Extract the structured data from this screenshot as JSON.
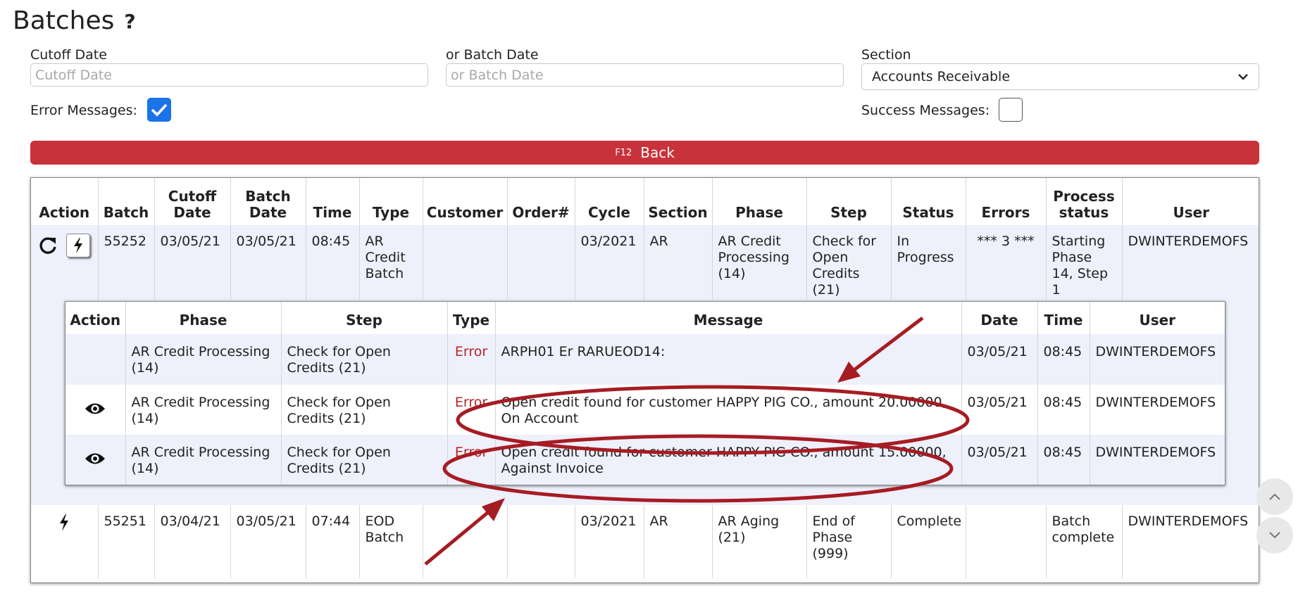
{
  "page": {
    "title": "Batches",
    "help_glyph": "?"
  },
  "filters": {
    "cutoff_label": "Cutoff Date",
    "cutoff_placeholder": "Cutoff Date",
    "batch_date_label": "or Batch Date",
    "batch_date_placeholder": "or Batch Date",
    "section_label": "Section",
    "section_value": "Accounts Receivable",
    "error_messages_label": "Error Messages:",
    "error_messages_checked": true,
    "success_messages_label": "Success Messages:",
    "success_messages_checked": false
  },
  "back_button": {
    "key": "F12",
    "label": "Back"
  },
  "batches": {
    "headers": {
      "action": "Action",
      "batch": "Batch",
      "cutoff_1": "Cutoff",
      "cutoff_2": "Date",
      "batch_date_1": "Batch",
      "batch_date_2": "Date",
      "time": "Time",
      "type": "Type",
      "customer": "Customer",
      "order": "Order#",
      "cycle": "Cycle",
      "section": "Section",
      "phase": "Phase",
      "step": "Step",
      "status": "Status",
      "errors": "Errors",
      "process_1": "Process",
      "process_2": "status",
      "user": "User"
    },
    "rows": [
      {
        "batch": "55252",
        "cutoff_date": "03/05/21",
        "batch_date": "03/05/21",
        "time": "08:45",
        "type": "AR Credit Batch",
        "customer": "",
        "order": "",
        "cycle": "03/2021",
        "section": "AR",
        "phase": "AR Credit Processing (14)",
        "step": "Check for Open Credits (21)",
        "status": "In Progress",
        "errors": "*** 3 ***",
        "process_status": "Starting Phase 14, Step 1",
        "user": "DWINTERDEMOFS"
      },
      {
        "batch": "55251",
        "cutoff_date": "03/04/21",
        "batch_date": "03/05/21",
        "time": "07:44",
        "type": "EOD Batch",
        "customer": "",
        "order": "",
        "cycle": "03/2021",
        "section": "AR",
        "phase": "AR Aging (21)",
        "step": "End of Phase (999)",
        "status": "Complete",
        "errors": "",
        "process_status": "Batch complete",
        "user": "DWINTERDEMOFS"
      }
    ]
  },
  "messages": {
    "headers": {
      "action": "Action",
      "phase": "Phase",
      "step": "Step",
      "type": "Type",
      "message": "Message",
      "date": "Date",
      "time": "Time",
      "user": "User"
    },
    "rows": [
      {
        "phase": "AR Credit Processing (14)",
        "step": "Check for Open Credits (21)",
        "type": "Error",
        "message": "ARPH01 Er RARUEOD14:",
        "date": "03/05/21",
        "time": "08:45",
        "user": "DWINTERDEMOFS"
      },
      {
        "phase": "AR Credit Processing (14)",
        "step": "Check for Open Credits (21)",
        "type": "Error",
        "message": "Open credit found for customer HAPPY PIG CO., amount 20.00000, On Account",
        "date": "03/05/21",
        "time": "08:45",
        "user": "DWINTERDEMOFS"
      },
      {
        "phase": "AR Credit Processing (14)",
        "step": "Check for Open Credits (21)",
        "type": "Error",
        "message": "Open credit found for customer HAPPY PIG CO., amount 15.00000, Against Invoice",
        "date": "03/05/21",
        "time": "08:45",
        "user": "DWINTERDEMOFS"
      }
    ]
  },
  "colors": {
    "accent_red": "#c8323a",
    "error_text": "#b32626",
    "checkbox_blue": "#1a73e8",
    "row_tint": "#eef0fb",
    "annotation": "#a61c24"
  },
  "icons": {
    "refresh": "refresh-icon",
    "run": "lightning-bolt-icon",
    "view": "eye-icon",
    "select_caret": "chevron-down-icon",
    "scroll_up": "chevron-up-icon",
    "scroll_down": "chevron-down-icon"
  }
}
